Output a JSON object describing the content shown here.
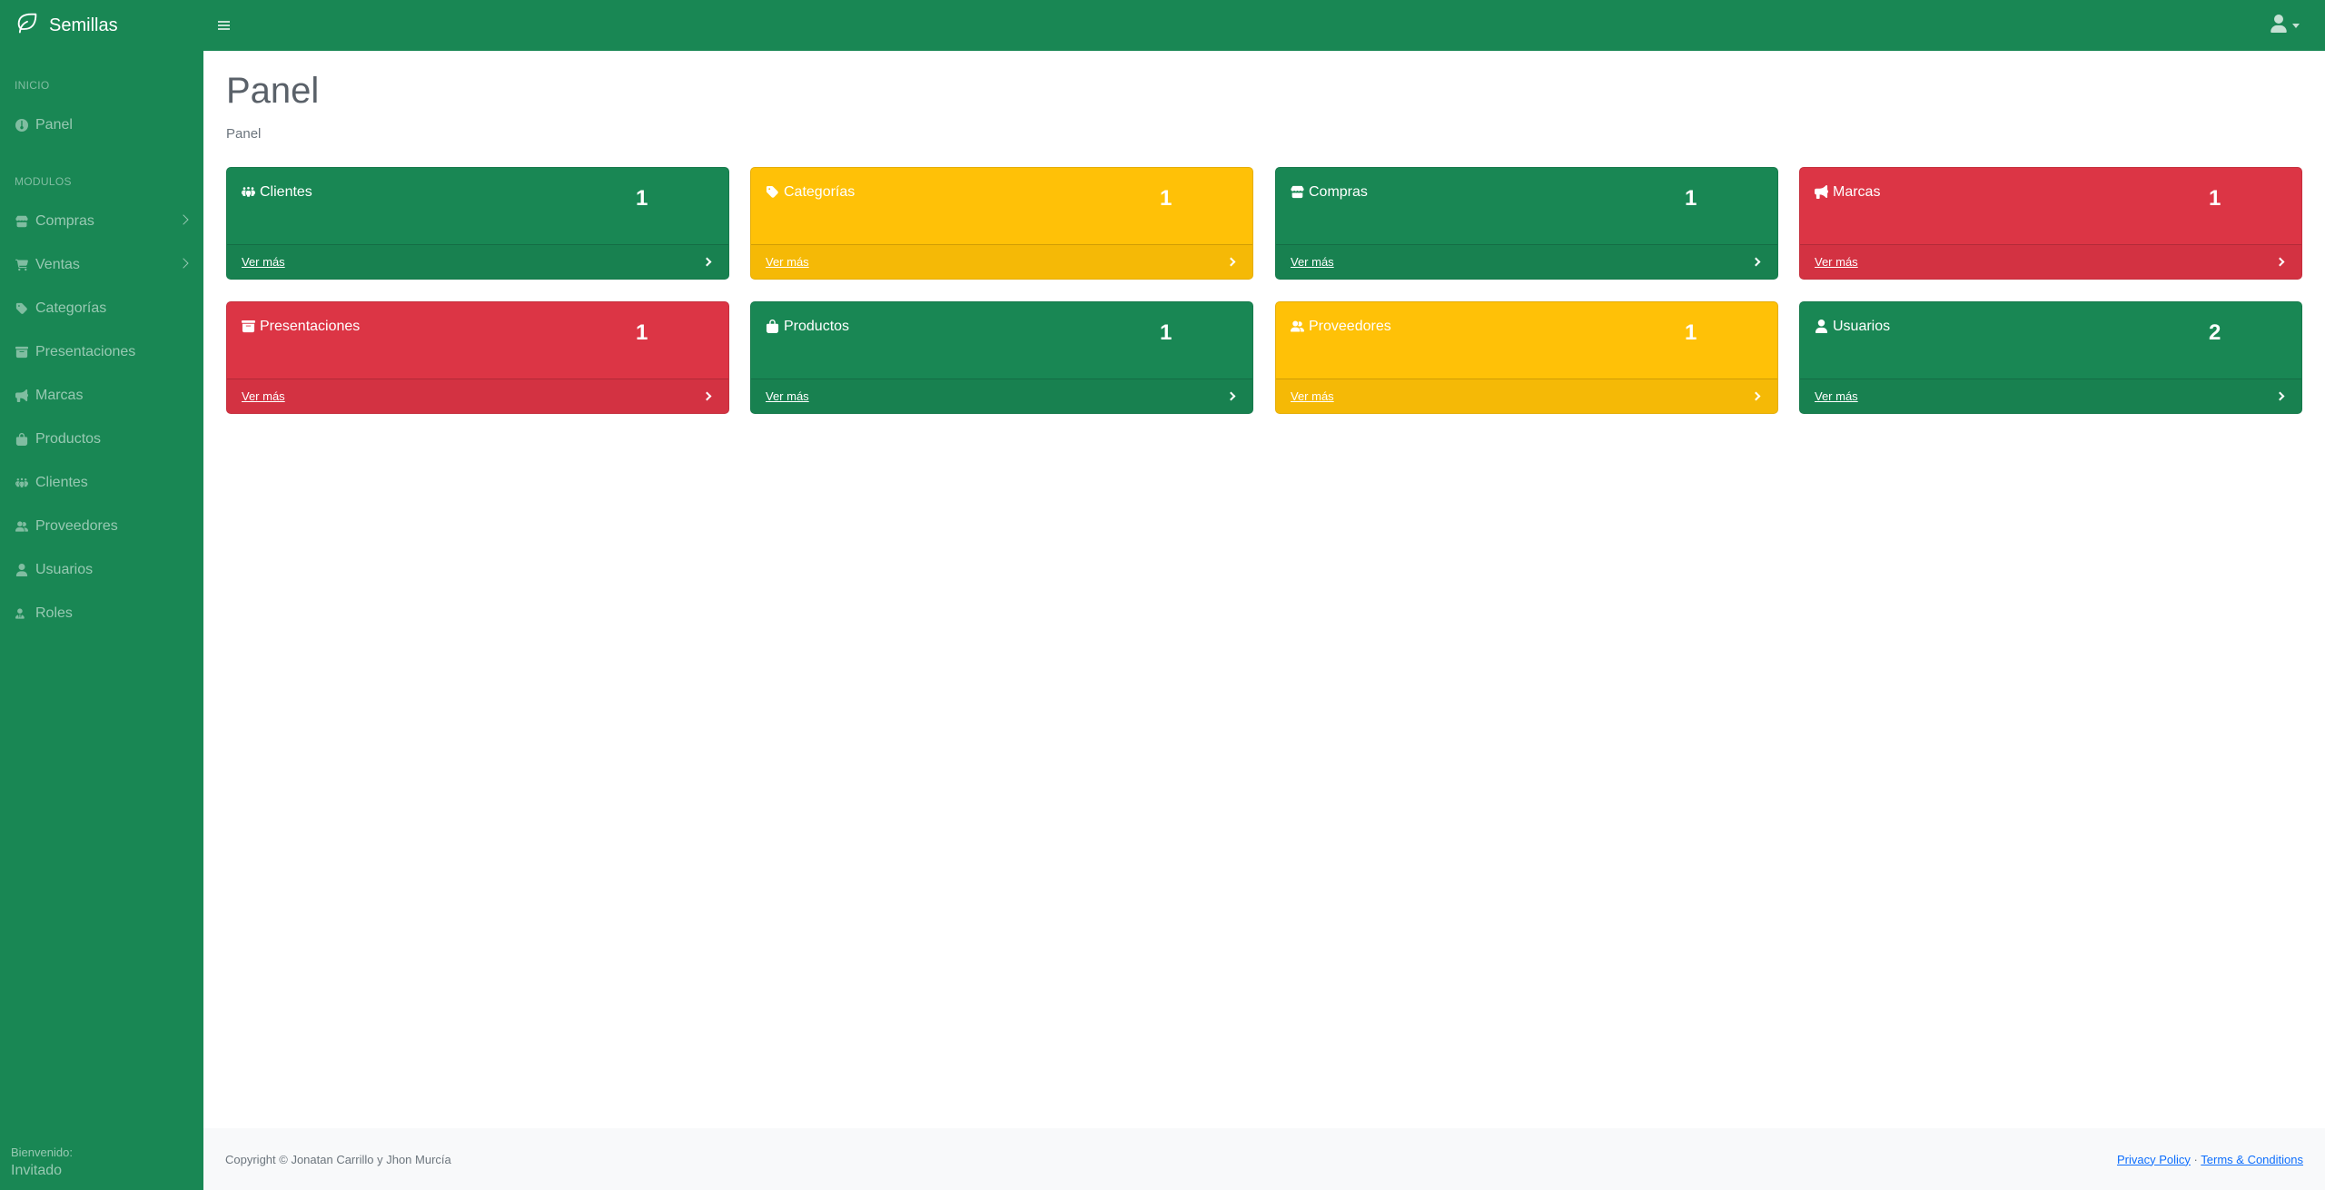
{
  "brand": {
    "name": "Semillas"
  },
  "sidebar": {
    "sections": [
      {
        "heading": "INICIO"
      },
      {
        "heading": "MODULOS"
      }
    ],
    "items": [
      {
        "label": "Panel",
        "icon": "gauge-icon"
      },
      {
        "label": "Compras",
        "icon": "store-icon",
        "expandable": true
      },
      {
        "label": "Ventas",
        "icon": "cart-icon",
        "expandable": true
      },
      {
        "label": "Categorías",
        "icon": "tag-icon"
      },
      {
        "label": "Presentaciones",
        "icon": "box-archive-icon"
      },
      {
        "label": "Marcas",
        "icon": "bullhorn-icon"
      },
      {
        "label": "Productos",
        "icon": "shopping-bag-icon"
      },
      {
        "label": "Clientes",
        "icon": "people-group-icon"
      },
      {
        "label": "Proveedores",
        "icon": "user-group-icon"
      },
      {
        "label": "Usuarios",
        "icon": "user-icon"
      },
      {
        "label": "Roles",
        "icon": "roles-icon"
      }
    ],
    "footer": {
      "welcome": "Bienvenido:",
      "user": "Invitado"
    }
  },
  "main": {
    "title": "Panel",
    "breadcrumb": "Panel",
    "cards": [
      {
        "title": "Clientes",
        "count": "1",
        "link": "Ver más",
        "color": "#198754",
        "icon": "people-group-icon"
      },
      {
        "title": "Categorías",
        "count": "1",
        "link": "Ver más",
        "color": "#ffc107",
        "icon": "tag-icon"
      },
      {
        "title": "Compras",
        "count": "1",
        "link": "Ver más",
        "color": "#198754",
        "icon": "store-icon"
      },
      {
        "title": "Marcas",
        "count": "1",
        "link": "Ver más",
        "color": "#dc3545",
        "icon": "bullhorn-icon"
      },
      {
        "title": "Presentaciones",
        "count": "1",
        "link": "Ver más",
        "color": "#dc3545",
        "icon": "box-archive-icon"
      },
      {
        "title": "Productos",
        "count": "1",
        "link": "Ver más",
        "color": "#198754",
        "icon": "shopping-bag-icon"
      },
      {
        "title": "Proveedores",
        "count": "1",
        "link": "Ver más",
        "color": "#ffc107",
        "icon": "user-group-icon"
      },
      {
        "title": "Usuarios",
        "count": "2",
        "link": "Ver más",
        "color": "#198754",
        "icon": "user-icon"
      }
    ]
  },
  "footer": {
    "copyright": "Copyright © Jonatan Carrillo y Jhon Murcía",
    "privacy": "Privacy Policy",
    "separator": "·",
    "terms": "Terms & Conditions"
  },
  "colors": {
    "primary": "#198754",
    "warning": "#ffc107",
    "danger": "#dc3545"
  }
}
